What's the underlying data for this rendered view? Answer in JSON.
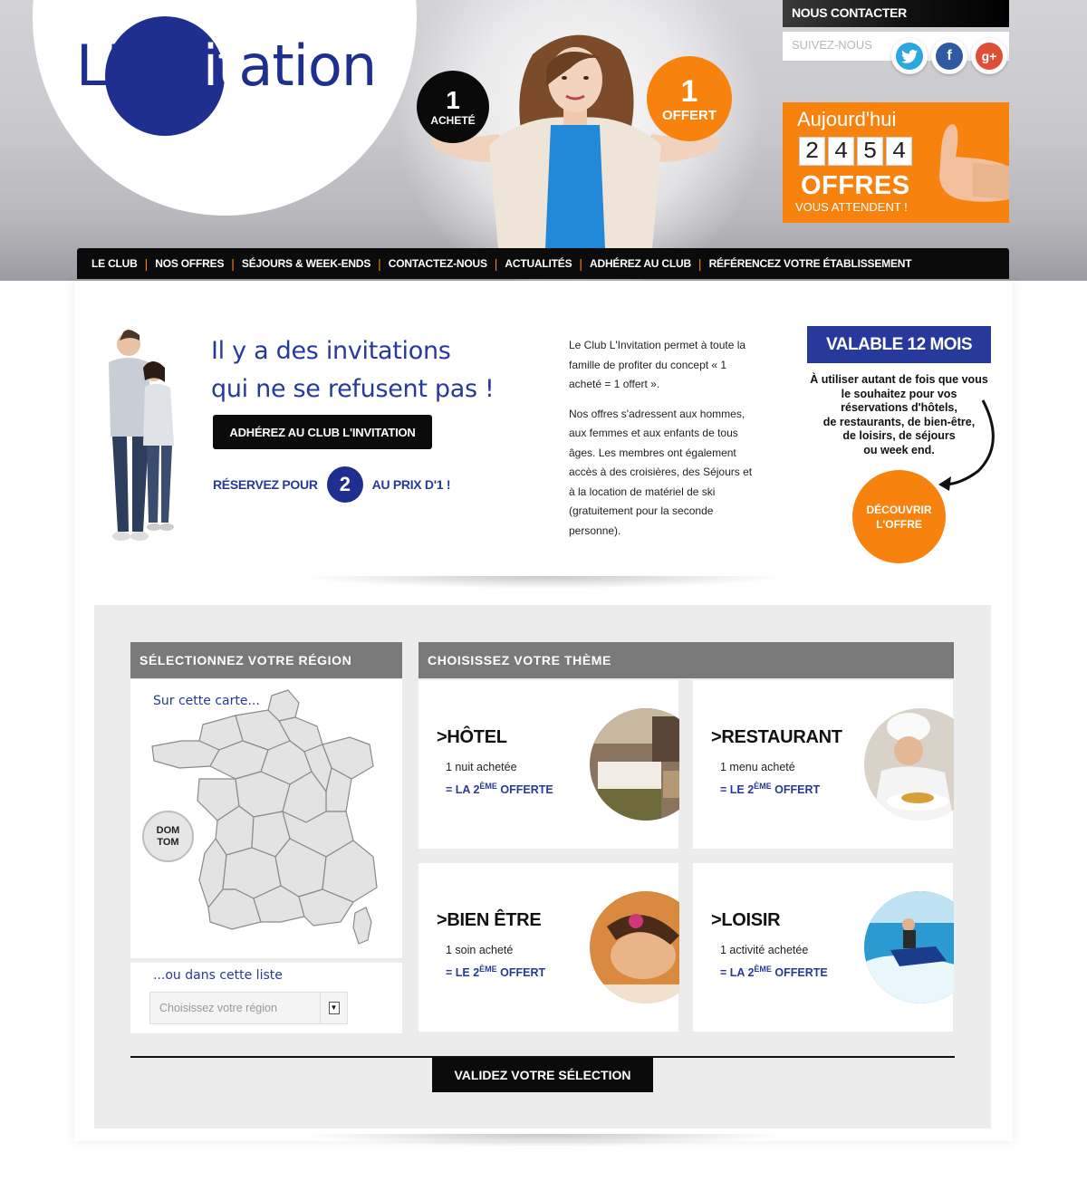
{
  "brand": {
    "logo_before": "L'inv",
    "logo_highlight": "it",
    "logo_after": "ation"
  },
  "hero": {
    "badge_left": {
      "number": "1",
      "label": "ACHETÉ"
    },
    "badge_right": {
      "number": "1",
      "label": "OFFERT"
    }
  },
  "top_right": {
    "contact_label": "NOUS CONTACTER",
    "follow_label": "SUIVEZ-NOUS",
    "social_icons": [
      "twitter-icon",
      "facebook-icon",
      "google-plus-icon"
    ]
  },
  "today_box": {
    "title": "Aujourd'hui",
    "digits": [
      "2",
      "4",
      "5",
      "4"
    ],
    "offers": "OFFRES",
    "subtitle": "VOUS ATTENDENT !"
  },
  "nav": {
    "items": [
      "LE CLUB",
      "NOS OFFRES",
      "SÉJOURS & WEEK-ENDS",
      "CONTACTEZ-NOUS",
      "ACTUALITÉS",
      "ADHÉREZ AU CLUB",
      "RÉFÉRENCEZ VOTRE ÉTABLISSEMENT"
    ]
  },
  "intro": {
    "headline_line1": "Il y a des invitations",
    "headline_line2": "qui ne se refusent pas !",
    "join_button": "ADHÉREZ AU CLUB L'INVITATION",
    "reserve_before": "RÉSERVEZ POUR",
    "reserve_number": "2",
    "reserve_after": "AU PRIX D'1 !",
    "paragraph1": "Le Club L'Invitation permet à toute la famille de profiter du concept « 1 acheté = 1 offert ».",
    "paragraph2": "Nos offres s'adressent aux hommes, aux femmes et aux enfants de tous âges. Les membres ont également accès à des croisières, des Séjours et à la location de matériel de ski (gratuitement pour la seconde personne)."
  },
  "valable": {
    "title": "VALABLE 12 MOIS",
    "line1": "À utiliser autant de fois que vous",
    "line2": "le souhaitez pour vos",
    "line3": "réservations d'hôtels,",
    "line4": "de restaurants, de bien-être,",
    "line5": "de loisirs, de séjours",
    "line6": "ou week end.",
    "discover_line1": "DÉCOUVRIR",
    "discover_line2": "L'OFFRE"
  },
  "region": {
    "header": "SÉLECTIONNEZ VOTRE RÉGION",
    "map_caption": "Sur cette carte...",
    "domtom_line1": "DOM",
    "domtom_line2": "TOM",
    "list_caption": "...ou dans cette liste",
    "select_placeholder": "Choisissez votre région"
  },
  "themes": {
    "header": "CHOISISSEZ VOTRE THÈME",
    "cards": [
      {
        "title": ">HÔTEL",
        "line1": "1 nuit achetée",
        "prefix": "= LA 2",
        "sup": "ÈME",
        "suffix": " OFFERTE"
      },
      {
        "title": ">RESTAURANT",
        "line1": "1 menu acheté",
        "prefix": "= LE 2",
        "sup": "ÈME",
        "suffix": " OFFERT"
      },
      {
        "title": ">BIEN ÊTRE",
        "line1": "1 soin acheté",
        "prefix": "= LE 2",
        "sup": "ÈME",
        "suffix": " OFFERT"
      },
      {
        "title": ">LOISIR",
        "line1": "1 activité achetée",
        "prefix": "= LA 2",
        "sup": "ÈME",
        "suffix": " OFFERTE"
      }
    ]
  },
  "validate_button": "VALIDEZ VOTRE SÉLECTION",
  "colors": {
    "brand_blue": "#1e2f8f",
    "accent_orange": "#f7820e",
    "nav_black": "#0b0b0b",
    "panel_gray": "#7a7a7a"
  }
}
